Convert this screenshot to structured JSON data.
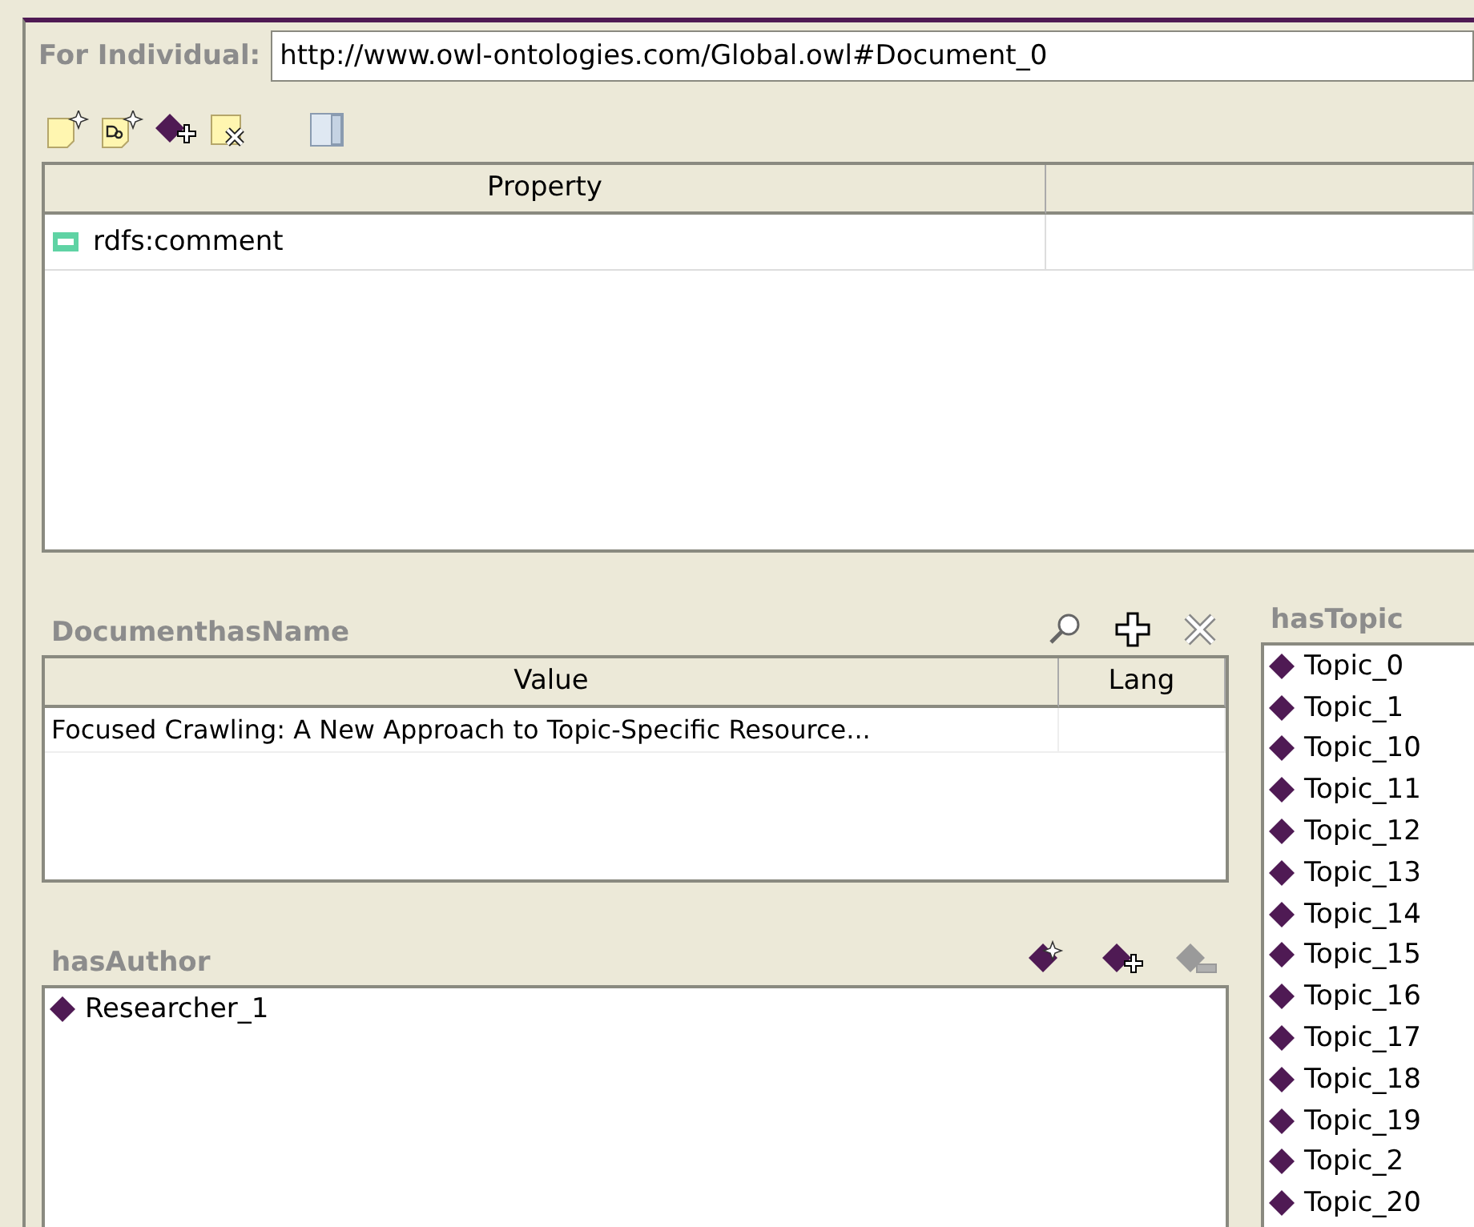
{
  "header": {
    "label": "For Individual:",
    "value": "http://www.owl-ontologies.com/Global.owl#Document_0"
  },
  "toolbar": [
    {
      "kind": "create"
    },
    {
      "kind": "create-doc"
    },
    {
      "kind": "add-instance"
    },
    {
      "kind": "delete"
    },
    {
      "kind": "layout"
    }
  ],
  "property_table": {
    "columns": [
      "Property"
    ],
    "rows": [
      {
        "property": "rdfs:comment"
      }
    ]
  },
  "name_panel": {
    "title": "DocumenthasName",
    "actions": [
      {
        "kind": "search"
      },
      {
        "kind": "add"
      },
      {
        "kind": "remove"
      }
    ],
    "columns": [
      "Value",
      "Lang"
    ],
    "rows": [
      {
        "value": "Focused Crawling: A New Approach to Topic-Specific Resource..."
      }
    ]
  },
  "author_panel": {
    "title": "hasAuthor",
    "actions": [
      {
        "kind": "create-instance",
        "disabled": false
      },
      {
        "kind": "add-instance",
        "disabled": false
      },
      {
        "kind": "remove-instance",
        "disabled": true
      }
    ],
    "items": [
      "Researcher_1"
    ]
  },
  "topic_panel": {
    "title": "hasTopic",
    "items": [
      "Topic_0",
      "Topic_1",
      "Topic_10",
      "Topic_11",
      "Topic_12",
      "Topic_13",
      "Topic_14",
      "Topic_15",
      "Topic_16",
      "Topic_17",
      "Topic_18",
      "Topic_19",
      "Topic_2",
      "Topic_20"
    ]
  }
}
